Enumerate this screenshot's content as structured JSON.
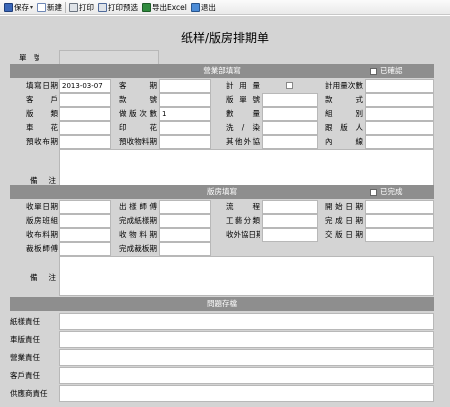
{
  "toolbar": {
    "save": "保存",
    "new": "新建",
    "print": "打印",
    "print_preview": "打印预选",
    "export_excel": "导出Excel",
    "exit": "退出"
  },
  "page_title": "纸样/版房排期单",
  "sheet_no": {
    "label": "單　號",
    "value": ""
  },
  "sales": {
    "header": "營業部填寫",
    "confirmed_label": "已確認",
    "rows": [
      [
        {
          "label": "填寫日期",
          "value": "2013-03-07"
        },
        {
          "label": "客期",
          "value": ""
        },
        {
          "label": "計用量",
          "checkbox": true
        },
        {
          "label": "計用量次數",
          "value": ""
        }
      ],
      [
        {
          "label": "客戶",
          "value": ""
        },
        {
          "label": "款號",
          "value": ""
        },
        {
          "label": "版單號",
          "value": ""
        },
        {
          "label": "款式",
          "value": ""
        }
      ],
      [
        {
          "label": "版類",
          "value": ""
        },
        {
          "label": "做版次數",
          "value": "1"
        },
        {
          "label": "數量",
          "value": ""
        },
        {
          "label": "組別",
          "value": ""
        }
      ],
      [
        {
          "label": "車花",
          "value": ""
        },
        {
          "label": "印花",
          "value": ""
        },
        {
          "label": "洗/染",
          "value": ""
        },
        {
          "label": "跟版人",
          "value": ""
        }
      ],
      [
        {
          "label": "預收布期",
          "value": ""
        },
        {
          "label": "預收物料期",
          "value": ""
        },
        {
          "label": "其他外協",
          "value": ""
        },
        {
          "label": "內線",
          "value": ""
        }
      ]
    ],
    "remarks_label": "備　注"
  },
  "plate_room": {
    "header": "版房填寫",
    "completed_label": "已完成",
    "rows": [
      [
        {
          "label": "收單日期",
          "value": ""
        },
        {
          "label": "出樣師傅",
          "value": ""
        },
        {
          "label": "流程",
          "value": ""
        },
        {
          "label": "開始日期",
          "value": ""
        }
      ],
      [
        {
          "label": "版房班組",
          "value": ""
        },
        {
          "label": "完成紙樣期",
          "value": ""
        },
        {
          "label": "工藝分類",
          "value": ""
        },
        {
          "label": "完成日期",
          "value": ""
        }
      ],
      [
        {
          "label": "收布料期",
          "value": ""
        },
        {
          "label": "收物料期",
          "value": ""
        },
        {
          "label": "收外協日期",
          "value": ""
        },
        {
          "label": "交版日期",
          "value": ""
        }
      ],
      [
        {
          "label": "裁板師傅",
          "value": ""
        },
        {
          "label": "完成裁板期",
          "value": ""
        }
      ]
    ],
    "remarks_label": "備　注"
  },
  "issues": {
    "header": "問題存檔",
    "rows": [
      "紙樣責任",
      "車版責任",
      "營業責任",
      "客戶責任",
      "供應商責任"
    ]
  }
}
